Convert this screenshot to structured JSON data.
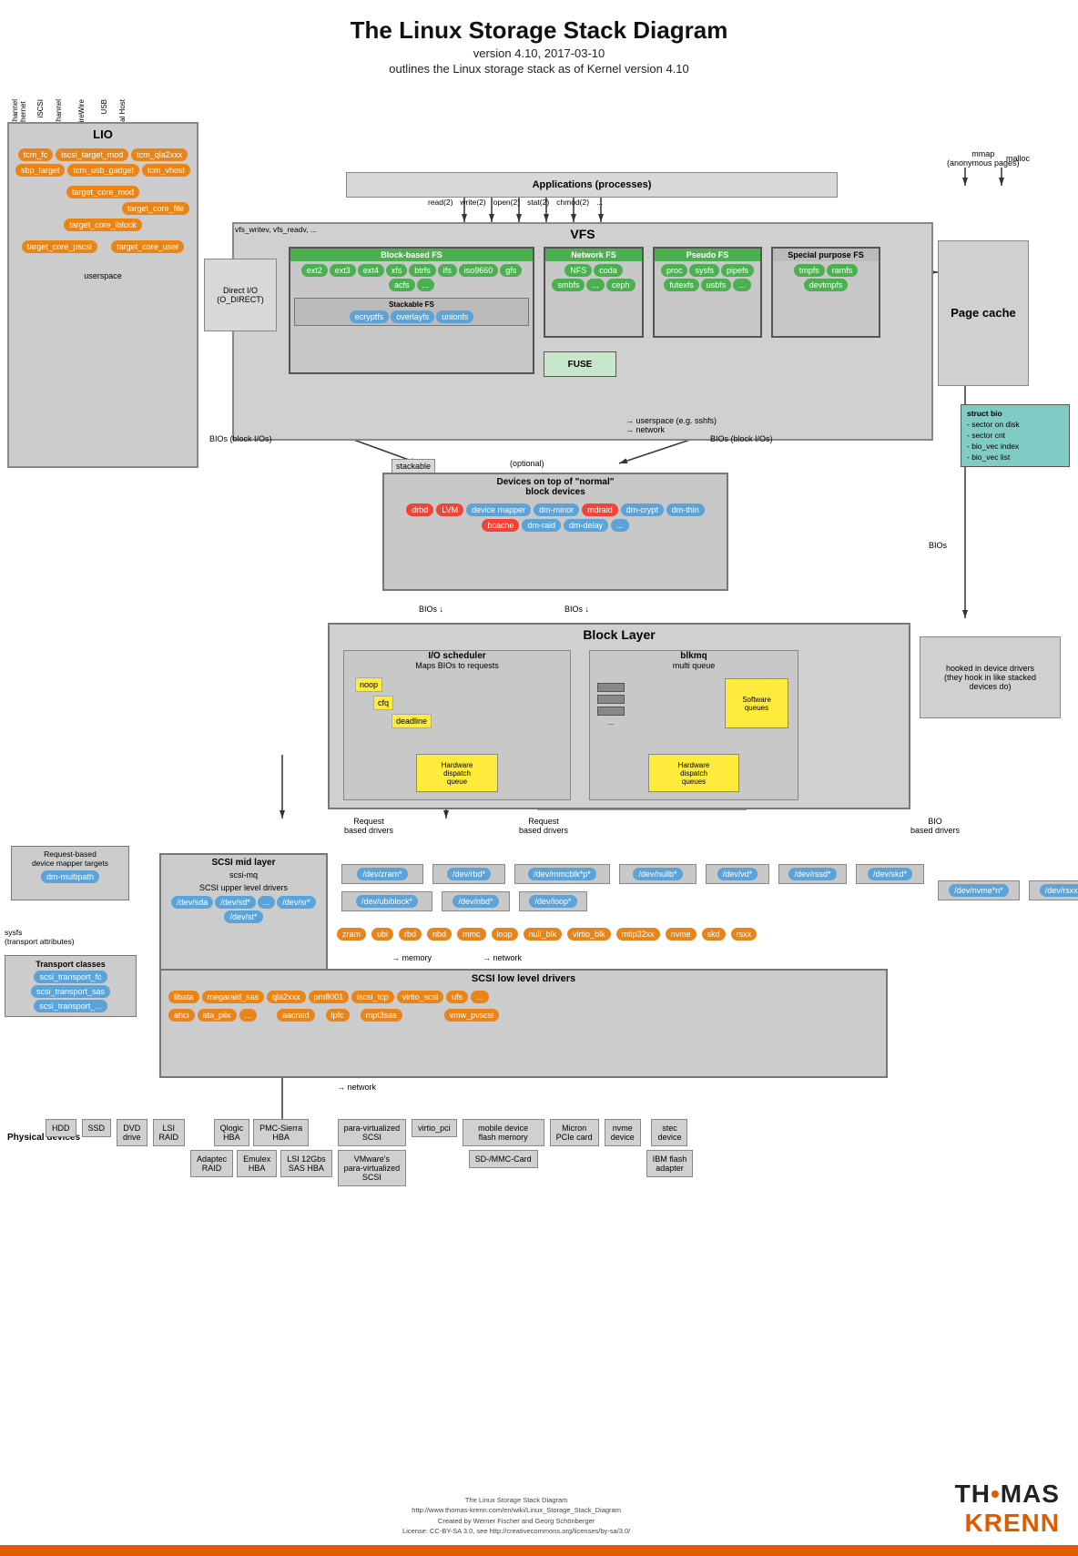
{
  "title": "The Linux Storage Stack Diagram",
  "subtitle1": "version 4.10, 2017-03-10",
  "subtitle2": "outlines the Linux storage stack as of Kernel version 4.10",
  "lio": {
    "label": "LIO",
    "items": [
      "tcm_fc",
      "iscsi_target_mod",
      "tcm_qla2xxx",
      "sbp_target",
      "tcm_usb_gadget",
      "tcm_vhost",
      "target_core_mod",
      "target_core_file",
      "target_core_iblock",
      "target_core_pscsi",
      "target_core_user"
    ]
  },
  "applications": "Applications (processes)",
  "syscalls": [
    "read(2)",
    "write(2)",
    "open(2)",
    "stat(2)",
    "chmod(2)",
    "..."
  ],
  "vfs": "VFS",
  "direct_io": "Direct I/O\n(O_DIRECT)",
  "vfs_calls": "vfs_writev, vfs_readv, ...",
  "block_fs": {
    "label": "Block-based FS",
    "items": [
      "ext2",
      "ext3",
      "ext4",
      "xfs",
      "btrfs",
      "ifs",
      "iso9660",
      "gfs",
      "acfs",
      "..."
    ]
  },
  "network_fs": {
    "label": "Network FS",
    "items": [
      "NFS",
      "coda",
      "smbfs",
      "...",
      "ceph"
    ]
  },
  "pseudo_fs": {
    "label": "Pseudo FS",
    "items": [
      "proc",
      "sysfs",
      "pipefs",
      "futexfs",
      "usbfs",
      "..."
    ]
  },
  "special_fs": {
    "label": "Special purpose FS",
    "items": [
      "tmpfs",
      "ramfs",
      "devtmpfs"
    ]
  },
  "stackable_fs": {
    "label": "Stackable FS",
    "items": [
      "ecryptfs",
      "overlayfs",
      "unionfs"
    ]
  },
  "fuse": "FUSE",
  "userspace_note": "userspace (e.g. sshfs)\nnetwork",
  "page_cache": "Page\ncache",
  "struct_bio": "struct bio\n- sector on disk\n- sector cnt\n- bio_vec index\n- bio_vec list",
  "mmap": "mmap\n(anonymous pages)",
  "malloc": "malloc",
  "stackable": "stackable",
  "optional": "(optional)",
  "devices_top": "Devices on top of \"normal\"\nblock devices",
  "block_devices": [
    "drbd",
    "LVM",
    "device mapper",
    "dm-minor",
    "mdraid",
    "dm-crypt",
    "dm-thin",
    "bcache",
    "dm-raid",
    "dm-delay",
    "..."
  ],
  "bios1": "BIOs (block I/Os)",
  "bios2": "BIOs (block I/Os)",
  "block_layer": "Block Layer",
  "io_scheduler": {
    "label": "I/O scheduler",
    "sublabel": "Maps BIOs to requests",
    "items": [
      "noop",
      "cfq",
      "deadline"
    ],
    "hw_queue": "Hardware\ndispatch\nqueue"
  },
  "blkmq": {
    "label": "blkmq",
    "sublabel": "multi queue",
    "sw_queues": "Software\nqueues",
    "hw_queues": "Hardware\ndispatch\nqueues"
  },
  "request_based_drivers1": "Request\nbased drivers",
  "request_based_drivers2": "Request\nbased drivers",
  "bio_based_drivers": "BIO\nbased drivers",
  "bios3": "BIOs",
  "hooked_drivers": "hooked in device drivers\n(they hook in like stacked\ndevices do)",
  "scsi_mid": {
    "label": "SCSI mid layer",
    "sub": "scsi-mq",
    "upper": "SCSI upper level drivers",
    "upper_devs": [
      "/dev/sda",
      "/dev/sd*",
      "...",
      "/dev/sr*",
      "/dev/st*"
    ]
  },
  "request_device_mapper": {
    "label": "Request-based\ndevice mapper targets",
    "item": "dm-multipath"
  },
  "sysfs_note": "sysfs\n(transport attributes)",
  "transport_classes": {
    "label": "Transport classes",
    "items": [
      "scsi_transport_fc",
      "scsi_transport_sas",
      "scsi_transport_..."
    ]
  },
  "dev_nodes": [
    "/dev/zram*",
    "/dev/rbd*",
    "/dev/mmcblk*p*",
    "/dev/nullb*",
    "/dev/vd*",
    "/dev/rssd*",
    "/dev/skd*",
    "/dev/ubiblock*",
    "/dev/nbd*",
    "/dev/loop*",
    "/dev/nvme*n*",
    "/dev/rsxx*"
  ],
  "drivers": [
    "zram",
    "ubi",
    "rbd",
    "nbd",
    "mmc",
    "loop",
    "null_blk",
    "virtio_blk",
    "mtip32xx",
    "nvme",
    "skd",
    "rsxx"
  ],
  "memory_note": "memory",
  "network_note": "network",
  "scsi_low": {
    "label": "SCSI low level drivers",
    "items": [
      "libata",
      "megaraid_sas",
      "qla2xxx",
      "pm8001",
      "iscsi_tcp",
      "virtio_scsi",
      "ufs",
      "...",
      "ahci",
      "ata_piix",
      "...",
      "aacraid",
      "lpfc",
      "mpt3sas",
      "vmw_pvscsi"
    ]
  },
  "network_note2": "network",
  "physical": {
    "label": "Physical devices",
    "items": [
      "HDD",
      "SSD",
      "DVD drive",
      "LSI RAID",
      "Qlogic HBA",
      "PMC-Sierra HBA",
      "para-virtualized SCSI",
      "virtio_pci",
      "mobile device flash memory",
      "Micron PCIe card",
      "nvme device",
      "stec device",
      "Adaptec RAID",
      "Emulex HBA",
      "LSI 12Gbs SAS HBA",
      "VMware's para-virtualized SCSI",
      "SD-/MMC-Card",
      "IBM flash adapter"
    ]
  },
  "brand": {
    "name1": "TH",
    "dot": "•",
    "name2": "MAS",
    "name3": "KRENN",
    "url": "http://www.thomas-krenn.com/en/wiki/Linux_Storage_Stack_Diagram",
    "license": "License: CC-BY-SA 3.0, see http://creativecommons.org/licenses/by-sa/3.0/"
  }
}
